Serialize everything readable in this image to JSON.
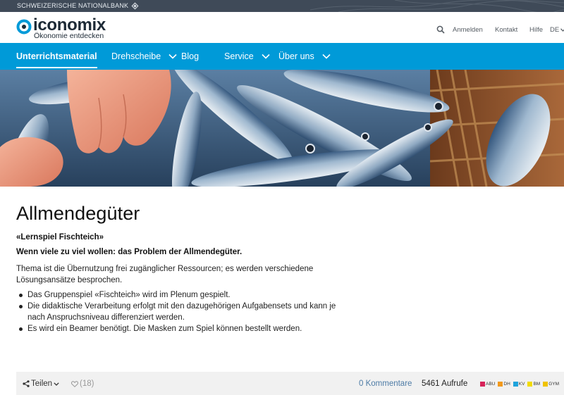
{
  "bankbar": {
    "label": "SCHWEIZERISCHE NATIONALBANK"
  },
  "header": {
    "logo_title": "iconomix",
    "logo_subtitle": "Ökonomie entdecken",
    "login": "Anmelden",
    "contact": "Kontakt",
    "help": "Hilfe",
    "language": "DE"
  },
  "nav": {
    "items": [
      {
        "label": "Unterrichtsmaterial"
      },
      {
        "label": "Drehscheibe"
      },
      {
        "label": "Blog"
      },
      {
        "label": "Service"
      },
      {
        "label": "Über uns"
      }
    ]
  },
  "article": {
    "title": "Allmendegüter",
    "kicker": "«Lernspiel Fischteich»",
    "lead": "Wenn viele zu viel wollen: das Problem der Allmendegüter.",
    "paragraph": "Thema ist die Übernutzung frei zugänglicher Ressourcen; es werden verschiedene Lösungsansätze besprochen.",
    "bullets": [
      "Das Gruppenspiel «Fischteich» wird im Plenum gespielt.",
      "Die didaktische Verarbeitung erfolgt mit den dazugehörigen Aufgabensets und kann je nach Anspruchsniveau differenziert werden.",
      "Es wird ein Beamer benötigt. Die Masken zum Spiel können bestellt werden."
    ]
  },
  "actions": {
    "share": "Teilen",
    "likes": "(18)",
    "comments": "0 Kommentare",
    "views": "5461 Aufrufe",
    "levels": [
      {
        "label": "ABU",
        "color": "#d6245a"
      },
      {
        "label": "DH",
        "color": "#f29a1d"
      },
      {
        "label": "KV",
        "color": "#1fa3dc"
      },
      {
        "label": "BM",
        "color": "#f2dc00"
      },
      {
        "label": "GYM",
        "color": "#f0c300"
      }
    ]
  },
  "colors": {
    "nav_blue": "#009ad8",
    "bankbar": "#3f4a58",
    "link": "#4e7ca6"
  }
}
